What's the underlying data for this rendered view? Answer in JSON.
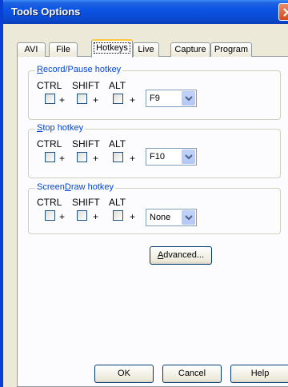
{
  "window": {
    "title": "Tools Options"
  },
  "tabs": [
    {
      "label": "AVI"
    },
    {
      "label": "File"
    },
    {
      "label": "Hotkeys"
    },
    {
      "label": "Live"
    },
    {
      "label": "Capture"
    },
    {
      "label": "Program"
    }
  ],
  "active_tab": "Hotkeys",
  "groups": [
    {
      "title_first": "R",
      "title_rest": "ecord/Pause hotkey",
      "ctrl_label": "CTRL",
      "shift_label": "SHIFT",
      "alt_label": "ALT",
      "plus": "+",
      "ctrl_checked": false,
      "shift_checked": false,
      "alt_checked": false,
      "key": "F9"
    },
    {
      "title_first": "S",
      "title_rest": "top hotkey",
      "ctrl_label": "CTRL",
      "shift_label": "SHIFT",
      "alt_label": "ALT",
      "plus": "+",
      "ctrl_checked": false,
      "shift_checked": false,
      "alt_checked": false,
      "key": "F10"
    },
    {
      "title_first": "ScreenD",
      "title_underline": "D",
      "title_rest": "raw hotkey",
      "ctrl_label": "CTRL",
      "shift_label": "SHIFT",
      "alt_label": "ALT",
      "plus": "+",
      "ctrl_checked": false,
      "shift_checked": false,
      "alt_checked": false,
      "key": "None"
    }
  ],
  "buttons": {
    "advanced_first": "A",
    "advanced_rest": "dvanced...",
    "ok": "OK",
    "cancel": "Cancel",
    "help": "Help"
  },
  "icons": {
    "close": "close-icon",
    "dropdown": "chevron-down-icon"
  },
  "colors": {
    "titlebar": "#0a4bd3",
    "group_title": "#0046d5",
    "active_tab_highlight": "#ffc83c"
  }
}
